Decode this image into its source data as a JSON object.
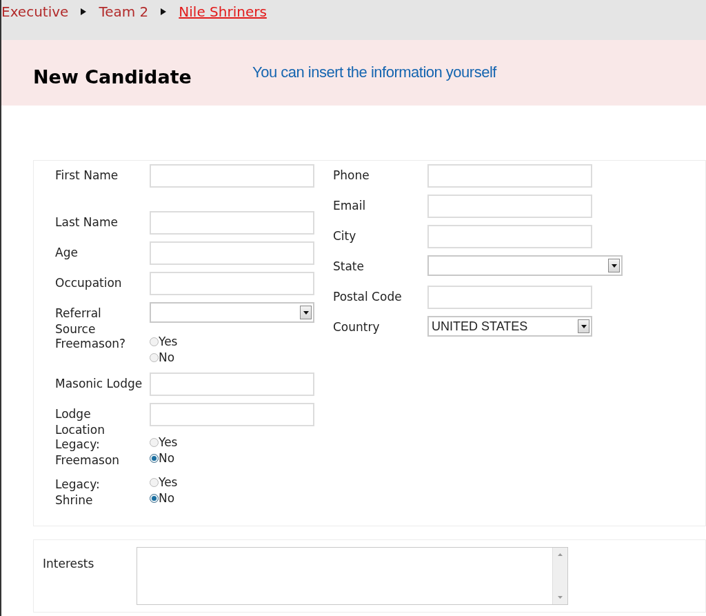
{
  "breadcrumb": [
    {
      "label": "Executive",
      "current": false
    },
    {
      "label": "Team 2",
      "current": false
    },
    {
      "label": "Nile Shriners",
      "current": true
    }
  ],
  "header": {
    "title": "New Candidate",
    "note": "You can insert the information yourself"
  },
  "left_fields": [
    {
      "kind": "text",
      "label": "First Name"
    },
    {
      "kind": "text",
      "label": "Last Name"
    },
    {
      "kind": "text",
      "label": "Age"
    },
    {
      "kind": "text",
      "label": "Occupation"
    },
    {
      "kind": "select",
      "label": "Referral\nSource"
    },
    {
      "kind": "radio",
      "label": "Freemason?",
      "options": [
        {
          "label": "Yes",
          "selected": false
        },
        {
          "label": "No",
          "selected": false
        }
      ]
    },
    {
      "kind": "text",
      "label": "Masonic Lodge"
    },
    {
      "kind": "text",
      "label": "Lodge\nLocation"
    },
    {
      "kind": "radio",
      "label": "Legacy:\nFreemason",
      "options": [
        {
          "label": "Yes",
          "selected": false
        },
        {
          "label": "No",
          "selected": true
        }
      ]
    },
    {
      "kind": "radio",
      "label": "Legacy:\nShrine",
      "options": [
        {
          "label": "Yes",
          "selected": false
        },
        {
          "label": "No",
          "selected": true
        }
      ]
    }
  ],
  "right_fields": [
    {
      "kind": "text",
      "label": "Phone"
    },
    {
      "kind": "text",
      "label": "Email"
    },
    {
      "kind": "text",
      "label": "City"
    },
    {
      "kind": "select",
      "label": "State",
      "wide": true
    },
    {
      "kind": "text",
      "label": "Postal Code"
    },
    {
      "kind": "select",
      "label": "Country",
      "value": "UNITED STATES",
      "wide": false
    }
  ],
  "interests": {
    "label": "Interests"
  }
}
